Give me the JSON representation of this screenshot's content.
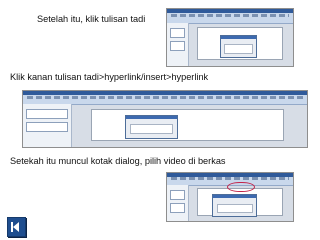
{
  "captions": {
    "step1": "Setelah itu, klik tulisan tadi",
    "step2": "Klik kanan tulisan tadi>hyperlink/insert>hyperlink",
    "step3": "Setekah itu muncul kotak dialog, pilih video di berkas"
  },
  "screenshots": [
    {
      "depicts": "PowerPoint window with hyperlink dialog"
    },
    {
      "depicts": "PowerPoint window with insert hyperlink menu"
    },
    {
      "depicts": "PowerPoint window with file dialog"
    }
  ],
  "navigation": {
    "back_icon": "previous-slide-icon",
    "accent_color": "#1f4e8f"
  }
}
